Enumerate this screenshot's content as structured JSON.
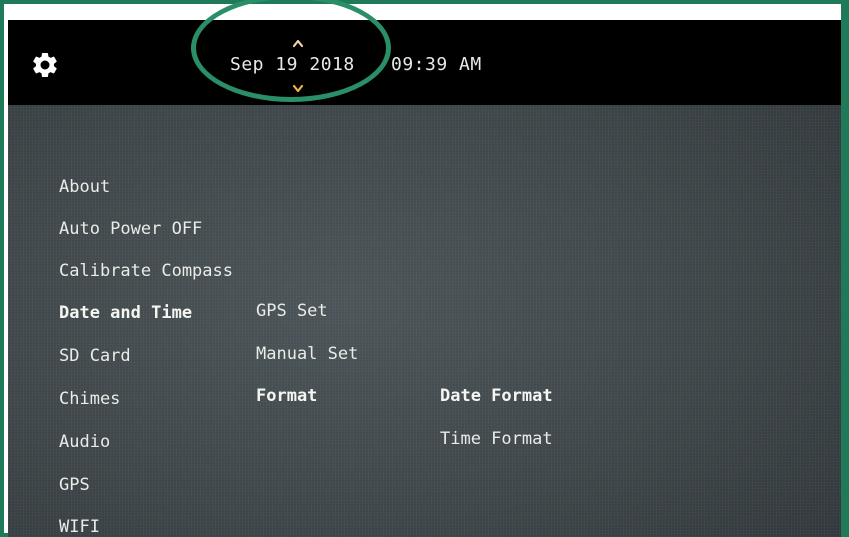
{
  "header": {
    "settings_icon": "gear-icon",
    "date": "Sep 19 2018",
    "time": "09:39 AM",
    "spinner_up_icon": "chevron-up-icon",
    "spinner_down_icon": "chevron-down-icon"
  },
  "menu": {
    "level1": [
      "About",
      "Auto Power OFF",
      "Calibrate Compass",
      "Date and Time",
      "SD Card",
      "Chimes",
      "Audio",
      "GPS",
      "WIFI"
    ],
    "level2": [
      "GPS Set",
      "Manual Set",
      "Format"
    ],
    "level3": [
      "Date Format",
      "Time Format"
    ]
  },
  "colors": {
    "topbar": "#000000",
    "screen": "#3d4548",
    "text": "#e9ece8",
    "frame_accent": "#1f7a5a"
  }
}
